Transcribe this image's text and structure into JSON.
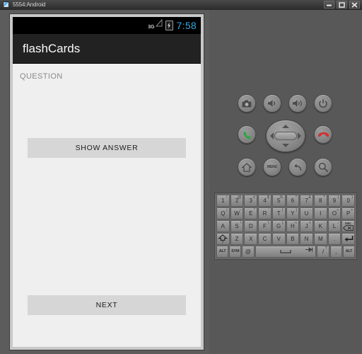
{
  "window": {
    "title": "5554:Android",
    "controls": [
      {
        "name": "minimize",
        "label": "–"
      },
      {
        "name": "maximize",
        "label": "□"
      },
      {
        "name": "close",
        "label": "✕"
      }
    ]
  },
  "phone": {
    "statusbar": {
      "network": "3G",
      "battery_icon": "battery-charging-icon",
      "signal_icon": "signal-bars-icon",
      "clock": "7:58",
      "clock_color": "#35a8e0"
    },
    "actionbar": {
      "app_title": "flashCards",
      "background": "#222222"
    },
    "content": {
      "background": "#efefef",
      "question_label": "QUESTION",
      "question_text": "",
      "show_answer_label": "SHOW ANSWER",
      "next_label": "NEXT",
      "button_background": "#d6d6d6"
    }
  },
  "panel": {
    "background": "#585858",
    "hardware_buttons": [
      {
        "name": "camera-button",
        "icon": "camera-icon"
      },
      {
        "name": "volume-down-button",
        "icon": "volume-down-icon"
      },
      {
        "name": "volume-up-button",
        "icon": "volume-up-icon"
      },
      {
        "name": "power-button",
        "icon": "power-icon"
      },
      {
        "name": "call-button",
        "icon": "phone-green-icon"
      },
      {
        "name": "end-call-button",
        "icon": "phone-red-icon"
      },
      {
        "name": "home-button",
        "icon": "home-icon"
      },
      {
        "name": "menu-button",
        "icon": "menu-text-icon",
        "label": "MENU"
      },
      {
        "name": "back-button",
        "icon": "back-arrow-icon"
      },
      {
        "name": "search-button",
        "icon": "search-icon"
      }
    ],
    "dpad": {
      "name": "dpad",
      "directions": [
        "up",
        "down",
        "left",
        "right"
      ],
      "center": "select"
    },
    "keyboard": {
      "rows": [
        [
          {
            "main": "1",
            "alt": "!"
          },
          {
            "main": "2",
            "alt": "@"
          },
          {
            "main": "3",
            "alt": "#"
          },
          {
            "main": "4",
            "alt": "$"
          },
          {
            "main": "5",
            "alt": "%"
          },
          {
            "main": "6",
            "alt": "^"
          },
          {
            "main": "7",
            "alt": "&"
          },
          {
            "main": "8",
            "alt": "*"
          },
          {
            "main": "9",
            "alt": "("
          },
          {
            "main": "0",
            "alt": ")"
          }
        ],
        [
          {
            "main": "Q",
            "alt": "|"
          },
          {
            "main": "W",
            "alt": "~"
          },
          {
            "main": "E",
            "alt": "\""
          },
          {
            "main": "R",
            "alt": "'"
          },
          {
            "main": "T",
            "alt": "{"
          },
          {
            "main": "Y",
            "alt": "}"
          },
          {
            "main": "U",
            "alt": "-"
          },
          {
            "main": "I",
            "alt": "_"
          },
          {
            "main": "O",
            "alt": "+"
          },
          {
            "main": "P",
            "alt": "="
          }
        ],
        [
          {
            "main": "A",
            "alt": ""
          },
          {
            "main": "S",
            "alt": "\\"
          },
          {
            "main": "D",
            "alt": "'"
          },
          {
            "main": "F",
            "alt": "["
          },
          {
            "main": "G",
            "alt": "]"
          },
          {
            "main": "H",
            "alt": "<"
          },
          {
            "main": "J",
            "alt": ">"
          },
          {
            "main": "K",
            "alt": ";"
          },
          {
            "main": "L",
            "alt": ":"
          },
          {
            "main": "DEL",
            "alt": "",
            "type": "del"
          }
        ],
        [
          {
            "main": "",
            "alt": "",
            "type": "shift"
          },
          {
            "main": "Z",
            "alt": ""
          },
          {
            "main": "X",
            "alt": ""
          },
          {
            "main": "C",
            "alt": ""
          },
          {
            "main": "V",
            "alt": ""
          },
          {
            "main": "B",
            "alt": ""
          },
          {
            "main": "N",
            "alt": ""
          },
          {
            "main": "M",
            "alt": ""
          },
          {
            "main": ".",
            "alt": ""
          },
          {
            "main": "",
            "alt": "",
            "type": "enter"
          }
        ],
        [
          {
            "main": "ALT",
            "alt": "",
            "type": "small"
          },
          {
            "main": "SYM",
            "alt": "",
            "type": "small"
          },
          {
            "main": "@",
            "alt": ""
          },
          {
            "main": "",
            "alt": "",
            "type": "space"
          },
          {
            "main": "/",
            "alt": "?"
          },
          {
            "main": ",",
            "alt": ""
          },
          {
            "main": "ALT",
            "alt": "",
            "type": "small"
          }
        ]
      ]
    }
  }
}
